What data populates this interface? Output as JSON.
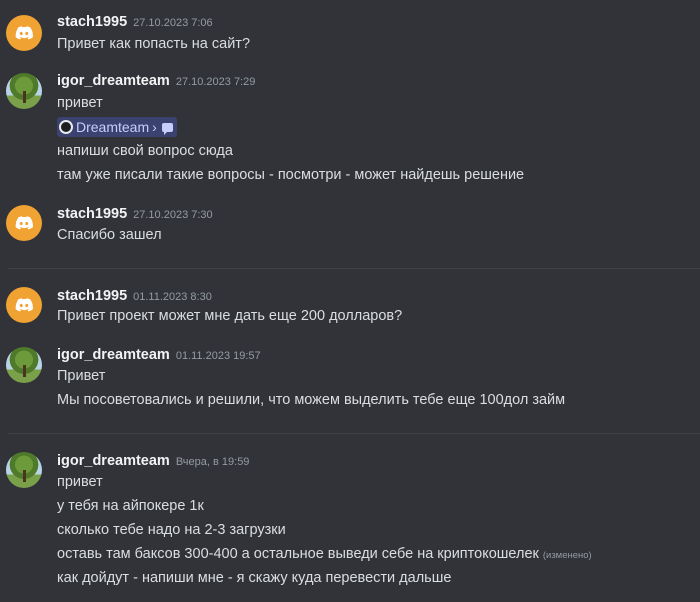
{
  "messages": [
    {
      "user": "stach1995",
      "time": "27.10.2023 7:06",
      "lines": [
        "Привет как попасть на сайт?"
      ]
    },
    {
      "user": "igor_dreamteam",
      "time": "27.10.2023 7:29",
      "lines": [
        "привет"
      ],
      "chip": {
        "label": "Dreamteam",
        "arrow": "›"
      },
      "lines2": [
        "напиши свой вопрос сюда",
        "там уже писали такие вопросы - посмотри - может найдешь решение"
      ]
    },
    {
      "user": "stach1995",
      "time": "27.10.2023 7:30",
      "lines": [
        "Спасибо зашел"
      ]
    },
    {
      "user": "stach1995",
      "time": "01.11.2023 8:30",
      "lines": [
        "Привет проект может мне дать еще 200 долларов?"
      ]
    },
    {
      "user": "igor_dreamteam",
      "time": "01.11.2023 19:57",
      "lines": [
        "Привет",
        "Мы посоветовались и решили, что можем выделить тебе еще 100дол займ"
      ]
    },
    {
      "user": "igor_dreamteam",
      "time": "Вчера, в 19:59",
      "lines": [
        "привет",
        "у тебя на айпокере 1к",
        "сколько тебе надо на 2-3 загрузки",
        "оставь там баксов 300-400 а остальное выведи себе на криптокошелек",
        "как дойдут - напиши мне - я скажу куда перевести дальше"
      ],
      "edited": "(изменено)"
    }
  ],
  "icons": {
    "discord": "discord-icon",
    "avatar_tree": "tree-avatar",
    "chip_server": "server-icon",
    "chip_channel": "chat-bubble-icon"
  },
  "colors": {
    "background": "#313338",
    "text": "#dbdee1",
    "username": "#f2f3f5",
    "timestamp": "#949ba4",
    "discord_avatar": "#f0a232",
    "mention_bg": "#3c4270"
  }
}
